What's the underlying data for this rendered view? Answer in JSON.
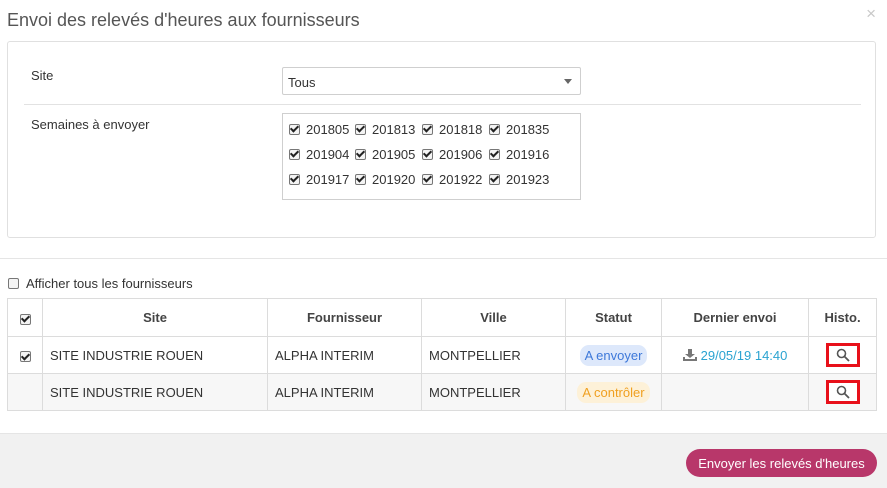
{
  "modal": {
    "title": "Envoi des relevés d'heures aux fournisseurs",
    "close_symbol": "×"
  },
  "form": {
    "site_label": "Site",
    "site_value": "Tous",
    "weeks_label": "Semaines à envoyer",
    "weeks": [
      {
        "label": "201805",
        "checked": true
      },
      {
        "label": "201813",
        "checked": true
      },
      {
        "label": "201818",
        "checked": true
      },
      {
        "label": "201835",
        "checked": true
      },
      {
        "label": "201904",
        "checked": true
      },
      {
        "label": "201905",
        "checked": true
      },
      {
        "label": "201906",
        "checked": true
      },
      {
        "label": "201916",
        "checked": true
      },
      {
        "label": "201917",
        "checked": true
      },
      {
        "label": "201920",
        "checked": true
      },
      {
        "label": "201922",
        "checked": true
      },
      {
        "label": "201923",
        "checked": true
      }
    ]
  },
  "show_all_label": "Afficher tous les fournisseurs",
  "table": {
    "headers": {
      "site": "Site",
      "supplier": "Fournisseur",
      "city": "Ville",
      "status": "Statut",
      "last_send": "Dernier envoi",
      "history": "Histo."
    },
    "rows": [
      {
        "checked": true,
        "site": "SITE INDUSTRIE ROUEN",
        "supplier": "ALPHA INTERIM",
        "city": "MONTPELLIER",
        "status": "A envoyer",
        "status_color": "#3d78d9",
        "last_send": "29/05/19 14:40"
      },
      {
        "checked": false,
        "site": "SITE INDUSTRIE ROUEN",
        "supplier": "ALPHA INTERIM",
        "city": "MONTPELLIER",
        "status": "A contrôler",
        "status_color": "#f0a020",
        "last_send": ""
      }
    ]
  },
  "footer": {
    "send_label": "Envoyer les relevés d'heures"
  },
  "colors": {
    "accent": "#b8376a",
    "highlight": "#e8101a",
    "link": "#2aa3d1"
  }
}
